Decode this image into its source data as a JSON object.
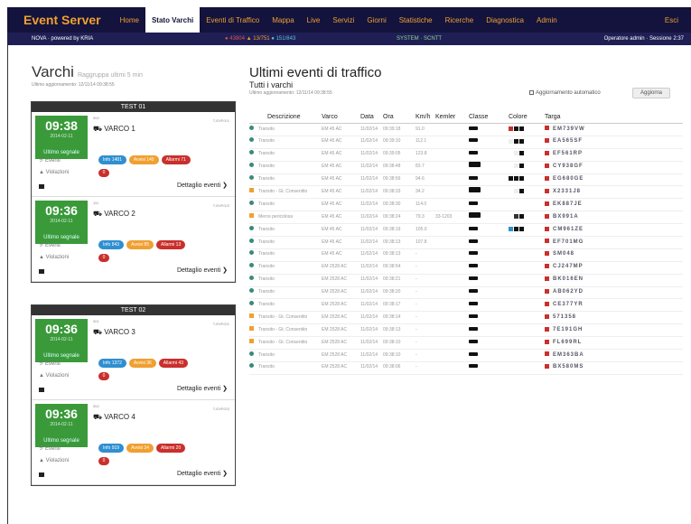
{
  "app": {
    "title": "Event Server",
    "exit": "Esci"
  },
  "nav": [
    "Home",
    "Stato Varchi",
    "Eventi di Traffico",
    "Mappa",
    "Live",
    "Servizi",
    "Giorni",
    "Statistiche",
    "Ricerche",
    "Diagnostica",
    "Admin"
  ],
  "status": {
    "version": "NOVA · powered by KRIA",
    "alert_r": "43804",
    "alert_o": "13/751",
    "alert_b": "151/843",
    "system": "SYSTEM · SCNTT",
    "user": "Operatore admin · Sessione 2:37"
  },
  "left": {
    "title": "Varchi",
    "subtitle": "Raggruppa ultimi 5 min",
    "updated": "Ultimo aggiornamento: 12/11/14 09:38:55",
    "groups": [
      {
        "name": "TEST 01",
        "gates": [
          {
            "time": "09:38",
            "date": "2014-02-11",
            "last": "Ultimo segnale",
            "num": "002",
            "name": "VARCO 1",
            "code": "T-EXP/1/1",
            "b1": "Info 1481",
            "b2": "Avvisi 140",
            "b3": "Allarmi 71",
            "violations": "0"
          },
          {
            "time": "09:36",
            "date": "2014-02-11",
            "last": "Ultimo segnale",
            "num": "111",
            "name": "VARCO 2",
            "code": "T-EXP/1/2",
            "b1": "Info 843",
            "b2": "Avvisi 85",
            "b3": "Allarmi 13",
            "violations": "0"
          }
        ]
      },
      {
        "name": "TEST 02",
        "gates": [
          {
            "time": "09:36",
            "date": "2014-02-11",
            "last": "Ultimo segnale",
            "num": "001",
            "name": "VARCO 3",
            "code": "T-EXP/2/1",
            "b1": "Info 1372",
            "b2": "Avvisi 36",
            "b3": "Allarmi 43",
            "violations": "0"
          },
          {
            "time": "09:36",
            "date": "2014-02-11",
            "last": "Ultimo segnale",
            "num": "002",
            "name": "VARCO 4",
            "code": "T-EXP/2/2",
            "b1": "Info 919",
            "b2": "Avvisi 34",
            "b3": "Allarmi 20",
            "violations": "0"
          }
        ]
      }
    ],
    "labels": {
      "events": "Eventi",
      "violations": "Violazioni",
      "details": "Dettaglio eventi ❯"
    }
  },
  "right": {
    "title": "Ultimi eventi di traffico",
    "subtitle": "Tutti i varchi",
    "updated": "Ultimo aggiornamento: 12/11/14 09:38:55",
    "auto": "Aggiornamento automatico",
    "refresh": "Aggiorna",
    "headers": [
      "Descrizione",
      "Varco",
      "Data",
      "Ora",
      "Km/h",
      "Kemler",
      "Classe",
      "Colore",
      "Targa"
    ],
    "rows": [
      {
        "w": false,
        "d": "Transito",
        "v": "EM 45 AC",
        "dt": "11/02/14",
        "h": "09:39:18",
        "k": "91.0",
        "ke": "",
        "big": false,
        "c": [
          "#c9302c",
          "#111",
          "#111"
        ],
        "p": "EM739VW"
      },
      {
        "w": false,
        "d": "Transito",
        "v": "EM 45 AC",
        "dt": "11/02/14",
        "h": "09:39:10",
        "k": "112.1",
        "ke": "",
        "big": false,
        "c": [
          "#eee",
          "#111",
          "#111"
        ],
        "p": "EA565SF"
      },
      {
        "w": false,
        "d": "Transito",
        "v": "EM 45 AC",
        "dt": "11/02/14",
        "h": "09:39:05",
        "k": "123.8",
        "ke": "",
        "big": false,
        "c": [
          "#fff",
          "#eee",
          "#111"
        ],
        "p": "EF561RP"
      },
      {
        "w": false,
        "d": "Transito",
        "v": "EM 45 AC",
        "dt": "11/02/14",
        "h": "09:38:48",
        "k": "83.7",
        "ke": "",
        "big": true,
        "c": [
          "#fff",
          "#eee",
          "#111"
        ],
        "p": "CY938GF"
      },
      {
        "w": false,
        "d": "Transito",
        "v": "EM 45 AC",
        "dt": "11/02/14",
        "h": "09:38:56",
        "k": "94.6",
        "ke": "",
        "big": false,
        "c": [
          "#111",
          "#111",
          "#111"
        ],
        "p": "EG680GE"
      },
      {
        "w": true,
        "d": "Transito - Gt. Consentito",
        "v": "EM 45 AC",
        "dt": "11/02/14",
        "h": "09:38:33",
        "k": "34.2",
        "ke": "",
        "big": true,
        "c": [
          "#fff",
          "#eee",
          "#111"
        ],
        "p": "X2331J8"
      },
      {
        "w": false,
        "d": "Transito",
        "v": "EM 45 AC",
        "dt": "11/02/14",
        "h": "09:38:30",
        "k": "114.0",
        "ke": "",
        "big": false,
        "c": [],
        "p": "EK887JE"
      },
      {
        "w": true,
        "d": "Merce pericolosa",
        "v": "EM 45 AC",
        "dt": "11/02/14",
        "h": "09:38:24",
        "k": "79.3",
        "ke": "33-1203",
        "big": true,
        "c": [
          "#fff",
          "#333",
          "#111"
        ],
        "p": "BX991A"
      },
      {
        "w": false,
        "d": "Transito",
        "v": "EM 45 AC",
        "dt": "11/02/14",
        "h": "09:38:19",
        "k": "105.0",
        "ke": "",
        "big": false,
        "c": [
          "#2f8fd0",
          "#111",
          "#111"
        ],
        "p": "CM961ZE"
      },
      {
        "w": false,
        "d": "Transito",
        "v": "EM 45 AC",
        "dt": "11/02/14",
        "h": "09:38:13",
        "k": "107.8",
        "ke": "",
        "big": false,
        "c": [],
        "p": "EF701MG"
      },
      {
        "w": false,
        "d": "Transito",
        "v": "EM 45 AC",
        "dt": "11/02/14",
        "h": "09:38:13",
        "k": "-",
        "ke": "",
        "big": false,
        "c": [],
        "p": "SM048"
      },
      {
        "w": false,
        "d": "Transito",
        "v": "EM 2528 AC",
        "dt": "11/02/14",
        "h": "09:38:54",
        "k": "-",
        "ke": "",
        "big": false,
        "c": [],
        "p": "CJ247MP"
      },
      {
        "w": false,
        "d": "Transito",
        "v": "EM 2528 AC",
        "dt": "11/02/14",
        "h": "09:38:21",
        "k": "-",
        "ke": "",
        "big": false,
        "c": [],
        "p": "BK016EN"
      },
      {
        "w": false,
        "d": "Transito",
        "v": "EM 2528 AC",
        "dt": "11/02/14",
        "h": "09:38:20",
        "k": "-",
        "ke": "",
        "big": false,
        "c": [],
        "p": "AB062YD"
      },
      {
        "w": false,
        "d": "Transito",
        "v": "EM 2528 AC",
        "dt": "11/02/14",
        "h": "09:38:17",
        "k": "-",
        "ke": "",
        "big": false,
        "c": [],
        "p": "CE377YR"
      },
      {
        "w": true,
        "d": "Transito - Gt. Consentito",
        "v": "EM 2528 AC",
        "dt": "11/02/14",
        "h": "09:38:14",
        "k": "-",
        "ke": "",
        "big": false,
        "c": [],
        "p": "571358"
      },
      {
        "w": true,
        "d": "Transito - Gt. Consentito",
        "v": "EM 2528 AC",
        "dt": "11/02/14",
        "h": "09:38:13",
        "k": "-",
        "ke": "",
        "big": false,
        "c": [],
        "p": "7E191GH"
      },
      {
        "w": true,
        "d": "Transito - Gt. Consentito",
        "v": "EM 2528 AC",
        "dt": "11/02/14",
        "h": "09:38:10",
        "k": "-",
        "ke": "",
        "big": false,
        "c": [],
        "p": "FL699RL"
      },
      {
        "w": false,
        "d": "Transito",
        "v": "EM 2528 AC",
        "dt": "11/02/14",
        "h": "09:38:10",
        "k": "-",
        "ke": "",
        "big": false,
        "c": [],
        "p": "EM363BA"
      },
      {
        "w": false,
        "d": "Transito",
        "v": "EM 2528 AC",
        "dt": "11/02/14",
        "h": "09:38:06",
        "k": "-",
        "ke": "",
        "big": false,
        "c": [],
        "p": "BX580MS"
      }
    ]
  }
}
